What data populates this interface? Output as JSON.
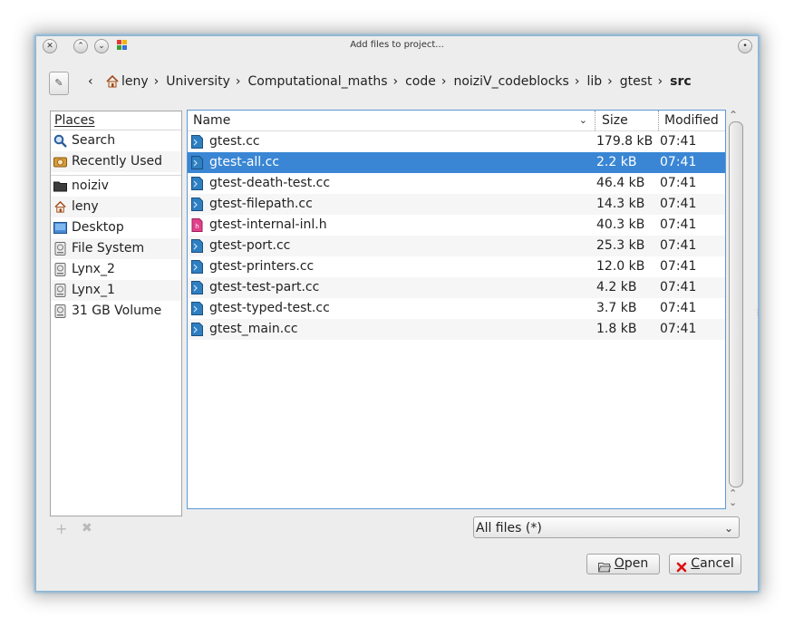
{
  "window": {
    "title": "Add files to project..."
  },
  "path_bar": {
    "crumbs": [
      "leny",
      "University",
      "Computational_maths",
      "code",
      "noiziV_codeblocks",
      "lib",
      "gtest"
    ],
    "current": "src",
    "back_glyph": "‹",
    "separator": "›"
  },
  "places": {
    "header": "Places",
    "items": [
      {
        "label": "Search",
        "icon": "search-icon"
      },
      {
        "label": "Recently Used",
        "icon": "recent-icon"
      },
      {
        "label": "noiziv",
        "icon": "folder-icon"
      },
      {
        "label": "leny",
        "icon": "home-icon"
      },
      {
        "label": "Desktop",
        "icon": "desktop-icon"
      },
      {
        "label": "File System",
        "icon": "drive-icon"
      },
      {
        "label": "Lynx_2",
        "icon": "drive-icon"
      },
      {
        "label": "Lynx_1",
        "icon": "drive-icon"
      },
      {
        "label": "31 GB Volume",
        "icon": "drive-icon"
      }
    ]
  },
  "files": {
    "columns": {
      "name": "Name",
      "size": "Size",
      "modified": "Modified"
    },
    "rows": [
      {
        "name": "gtest.cc",
        "size": "179.8 kB",
        "modified": "07:41",
        "type": "cpp"
      },
      {
        "name": "gtest-all.cc",
        "size": "2.2 kB",
        "modified": "07:41",
        "type": "cpp",
        "selected": true
      },
      {
        "name": "gtest-death-test.cc",
        "size": "46.4 kB",
        "modified": "07:41",
        "type": "cpp"
      },
      {
        "name": "gtest-filepath.cc",
        "size": "14.3 kB",
        "modified": "07:41",
        "type": "cpp"
      },
      {
        "name": "gtest-internal-inl.h",
        "size": "40.3 kB",
        "modified": "07:41",
        "type": "header"
      },
      {
        "name": "gtest-port.cc",
        "size": "25.3 kB",
        "modified": "07:41",
        "type": "cpp"
      },
      {
        "name": "gtest-printers.cc",
        "size": "12.0 kB",
        "modified": "07:41",
        "type": "cpp"
      },
      {
        "name": "gtest-test-part.cc",
        "size": "4.2 kB",
        "modified": "07:41",
        "type": "cpp"
      },
      {
        "name": "gtest-typed-test.cc",
        "size": "3.7 kB",
        "modified": "07:41",
        "type": "cpp"
      },
      {
        "name": "gtest_main.cc",
        "size": "1.8 kB",
        "modified": "07:41",
        "type": "cpp"
      }
    ]
  },
  "filter": {
    "selected": "All files (*)"
  },
  "buttons": {
    "open_label": "Open",
    "open_mnemonic": "O",
    "open_rest": "pen",
    "cancel_label": "Cancel",
    "cancel_mnemonic": "C",
    "cancel_rest": "ancel"
  },
  "colors": {
    "selection": "#3a86d4",
    "frame_glow": "#7fb2d6",
    "cpp_icon": "#2f7fc0",
    "header_icon": "#e0408a"
  }
}
